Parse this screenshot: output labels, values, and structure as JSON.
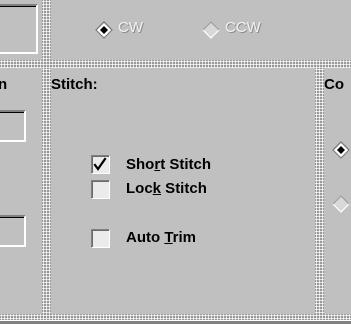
{
  "rotation": {
    "options": [
      {
        "key": "cw",
        "label": "CW",
        "selected": true
      },
      {
        "key": "ccw",
        "label": "CCW",
        "selected": false
      }
    ]
  },
  "left_panel": {
    "header_fragment": "n"
  },
  "stitch": {
    "title": "Stitch:",
    "options": [
      {
        "key": "short",
        "pre": "Sho",
        "mnemonic": "r",
        "post": "t Stitch",
        "checked": true
      },
      {
        "key": "lock",
        "pre": "Loc",
        "mnemonic": "k",
        "post": " Stitch",
        "checked": false
      },
      {
        "key": "trim",
        "pre": "Auto ",
        "mnemonic": "T",
        "post": "rim",
        "checked": false
      }
    ]
  },
  "right_panel": {
    "title_fragment": "Co"
  },
  "colors": {
    "face": "#c0c0c0",
    "shadow": "#808080",
    "highlight": "#ffffff",
    "checkbox_face": "#ebebeb",
    "dark": "#000000"
  },
  "icons": {
    "radio_selected": "diamond-radio-filled",
    "radio_unselected": "diamond-radio-empty",
    "check": "checkmark"
  }
}
